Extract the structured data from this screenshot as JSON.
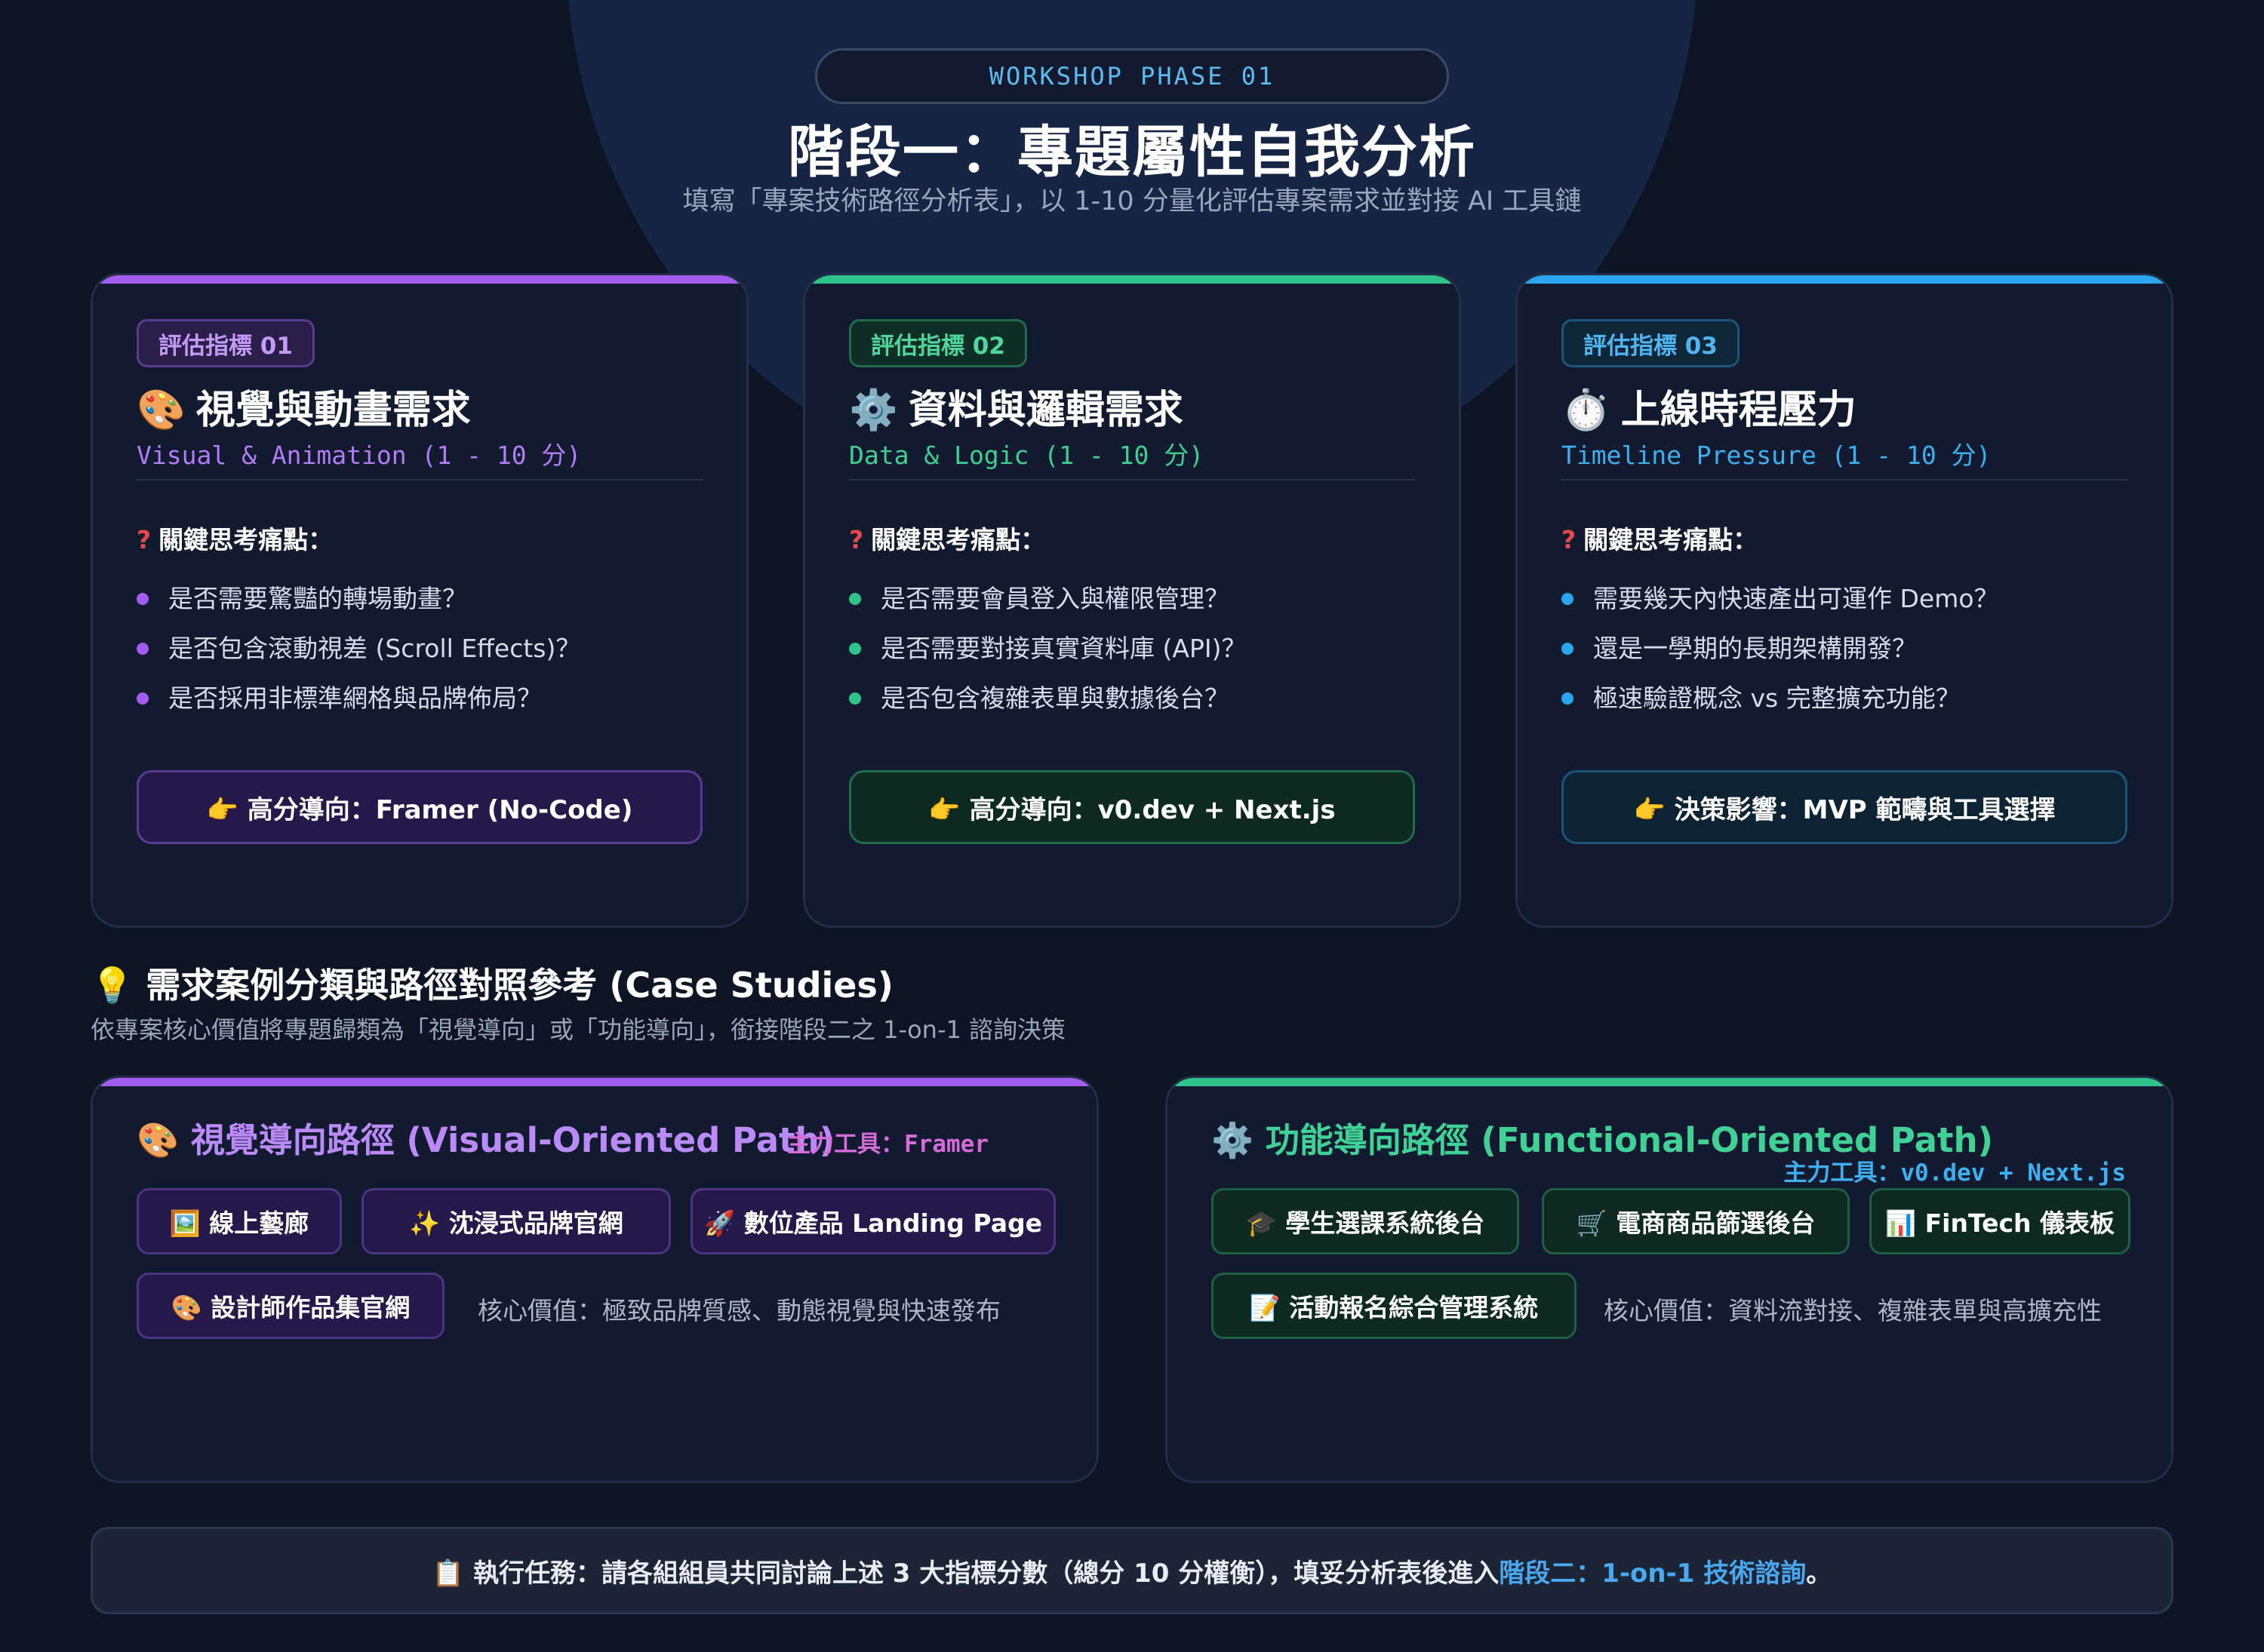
{
  "header": {
    "badge": "WORKSHOP PHASE 01",
    "title": "階段一：專題屬性自我分析",
    "subtitle": "填寫「專案技術路徑分析表」，以 1-10 分量化評估專案需求並對接 AI 工具鏈"
  },
  "colors": {
    "purple": "#a25df0",
    "green": "#2fc58a",
    "blue": "#2aa6ef"
  },
  "metrics": [
    {
      "tag": "評估指標 01",
      "emoji": "🎨",
      "title": "視覺與動畫需求",
      "subtitle": "Visual & Animation (1 - 10 分)",
      "pain_label": "關鍵思考痛點：",
      "bullets": [
        "是否需要驚豔的轉場動畫？",
        "是否包含滾動視差 (Scroll Effects)？",
        "是否採用非標準網格與品牌佈局？"
      ],
      "action": "👉 高分導向：Framer (No-Code)"
    },
    {
      "tag": "評估指標 02",
      "emoji": "⚙️",
      "title": "資料與邏輯需求",
      "subtitle": "Data & Logic (1 - 10 分)",
      "pain_label": "關鍵思考痛點：",
      "bullets": [
        "是否需要會員登入與權限管理？",
        "是否需要對接真實資料庫 (API)？",
        "是否包含複雜表單與數據後台？"
      ],
      "action": "👉 高分導向：v0.dev + Next.js"
    },
    {
      "tag": "評估指標 03",
      "emoji": "⏱️",
      "title": "上線時程壓力",
      "subtitle": "Timeline Pressure (1 - 10 分)",
      "pain_label": "關鍵思考痛點：",
      "bullets": [
        "需要幾天內快速產出可運作 Demo？",
        "還是一學期的長期架構開發？",
        "極速驗證概念 vs 完整擴充功能？"
      ],
      "action": "👉 決策影響：MVP 範疇與工具選擇"
    }
  ],
  "case_studies": {
    "title": "💡 需求案例分類與路徑對照參考 (Case Studies)",
    "subtitle": "依專案核心價值將專題歸類為「視覺導向」或「功能導向」，銜接階段二之 1-on-1 諮詢決策"
  },
  "visual_path": {
    "title": "🎨 視覺導向路徑 (Visual-Oriented Path)",
    "tool": "主力工具：Framer",
    "chips": [
      "🖼️ 線上藝廊",
      "✨ 沈浸式品牌官網",
      "🚀 數位產品 Landing Page",
      "🎨 設計師作品集官網"
    ],
    "core": "核心價值：極致品牌質感、動態視覺與快速發布"
  },
  "functional_path": {
    "title": "⚙️ 功能導向路徑 (Functional-Oriented Path)",
    "tool": "主力工具：v0.dev + Next.js",
    "chips": [
      "🎓 學生選課系統後台",
      "🛒 電商商品篩選後台",
      "📊 FinTech 儀表板",
      "📝 活動報名綜合管理系統"
    ],
    "core": "核心價值：資料流對接、複雜表單與高擴充性"
  },
  "footer": {
    "text": "📋 執行任務：請各組組員共同討論上述 3 大指標分數（總分 10 分權衡），填妥分析表後進入 ",
    "link": "階段二：1-on-1 技術諮詢",
    "end": "。"
  }
}
